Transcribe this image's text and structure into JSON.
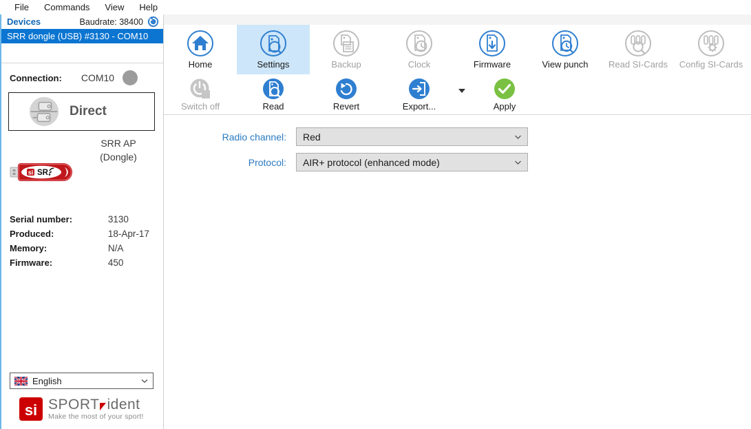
{
  "menubar": {
    "items": [
      {
        "label": "File"
      },
      {
        "label": "Commands"
      },
      {
        "label": "View"
      },
      {
        "label": "Help"
      }
    ]
  },
  "sidebar": {
    "devices_title": "Devices",
    "baudrate": "Baudrate: 38400",
    "refresh_icon": "refresh-icon",
    "device_selected": "SRR dongle (USB) #3130 - COM10",
    "connection": {
      "label": "Connection:",
      "value": "COM10",
      "status_color": "#9c9c9c"
    },
    "direct": {
      "label": "Direct",
      "icon": "device-direct-icon"
    },
    "dongle": {
      "caption_line1": "SRR AP",
      "caption_line2": "(Dongle)",
      "icon": "srr-usb-dongle-icon",
      "badge_text": "SR"
    },
    "info": [
      {
        "key": "Serial number:",
        "value": "3130"
      },
      {
        "key": "Produced:",
        "value": "18-Apr-17"
      },
      {
        "key": "Memory:",
        "value": "N/A"
      },
      {
        "key": "Firmware:",
        "value": "450"
      }
    ],
    "language": {
      "value": "English",
      "flag_icon": "uk-flag-icon",
      "caret_icon": "chevron-down-icon"
    },
    "brand": {
      "word_sport": "SPORT",
      "word_ident": "ident",
      "tagline": "Make the most of your sport!",
      "mark_text": "si",
      "accent": "#cc0000"
    }
  },
  "ribbon": {
    "row1": [
      {
        "label": "Home",
        "icon": "home-icon",
        "state": "enabled",
        "name": "tab-home"
      },
      {
        "label": "Settings",
        "icon": "settings-icon",
        "state": "selected",
        "name": "tab-settings"
      },
      {
        "label": "Backup",
        "icon": "backup-icon",
        "state": "disabled",
        "name": "tab-backup"
      },
      {
        "label": "Clock",
        "icon": "clock-icon",
        "state": "disabled",
        "name": "tab-clock"
      },
      {
        "label": "Firmware",
        "icon": "firmware-icon",
        "state": "enabled",
        "name": "tab-firmware"
      },
      {
        "label": "View punch",
        "icon": "view-punch-icon",
        "state": "enabled",
        "name": "tab-view-punch"
      },
      {
        "label": "Read SI-Cards",
        "icon": "read-si-cards-icon",
        "state": "disabled",
        "name": "tab-read-si-cards"
      },
      {
        "label": "Config SI-Cards",
        "icon": "config-si-cards-icon",
        "state": "disabled",
        "name": "tab-config-si-cards"
      }
    ],
    "row2": [
      {
        "label": "Switch off",
        "icon": "power-icon",
        "state": "disabled",
        "name": "button-switch-off"
      },
      {
        "label": "Read",
        "icon": "read-icon",
        "state": "enabled",
        "name": "button-read"
      },
      {
        "label": "Revert",
        "icon": "revert-icon",
        "state": "enabled",
        "name": "button-revert"
      },
      {
        "label": "Export...",
        "icon": "export-icon",
        "state": "enabled",
        "name": "button-export"
      },
      {
        "label": "Apply",
        "icon": "apply-icon",
        "state": "enabled",
        "name": "button-apply"
      }
    ],
    "export_caret_icon": "caret-down-icon",
    "accent_blue": "#2f7fd1",
    "selected_bg": "#cde6f9",
    "apply_green": "#7ac143"
  },
  "form": {
    "fields": [
      {
        "label": "Radio channel:",
        "value": "Red",
        "name": "radio-channel"
      },
      {
        "label": "Protocol:",
        "value": "AIR+ protocol (enhanced mode)",
        "name": "protocol"
      }
    ],
    "caret_icon": "chevron-down-icon"
  }
}
